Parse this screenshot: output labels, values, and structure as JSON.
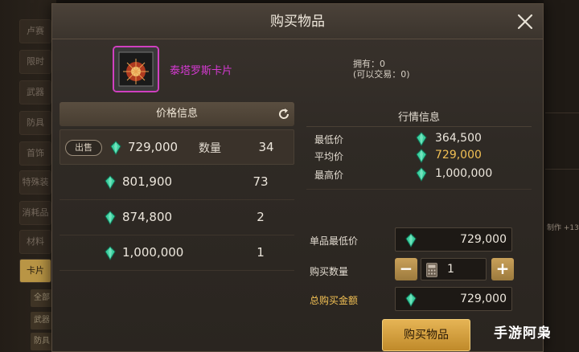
{
  "background": {
    "left_tabs": [
      "卢赛",
      "限时",
      "武器",
      "防具",
      "首饰",
      "特殊装",
      "消耗品",
      "材料",
      "卡片"
    ],
    "left_subtabs": [
      "全部",
      "武器",
      "防具"
    ],
    "right_text": "制作 +13"
  },
  "dialog": {
    "title": "购买物品",
    "item": {
      "name": "泰塔罗斯卡片",
      "name_color": "#d43ad1",
      "own": "拥有：0",
      "tradable": "(可以交易：0)"
    },
    "price_panel": {
      "title": "价格信息",
      "sell_label": "出售",
      "qty_label": "数量",
      "rows": [
        {
          "price": "729,000",
          "qty": "34"
        },
        {
          "price": "801,900",
          "qty": "73"
        },
        {
          "price": "874,800",
          "qty": "2"
        },
        {
          "price": "1,000,000",
          "qty": "1"
        }
      ]
    },
    "market": {
      "title": "行情信息",
      "min_label": "最低价",
      "min_value": "364,500",
      "avg_label": "平均价",
      "avg_value": "729,000",
      "max_label": "最高价",
      "max_value": "1,000,000"
    },
    "form": {
      "unit_min_label": "单品最低价",
      "unit_min_value": "729,000",
      "qty_label": "购买数量",
      "qty_value": "1",
      "minus": "−",
      "plus": "+",
      "total_label": "总购买金额",
      "total_value": "729,000"
    },
    "buy_button": "购买物品"
  },
  "watermark": "手游阿枭",
  "colors": {
    "accent_gold": "#f2c054",
    "gem": "#3fd0a0",
    "item_purple": "#d040c0"
  }
}
